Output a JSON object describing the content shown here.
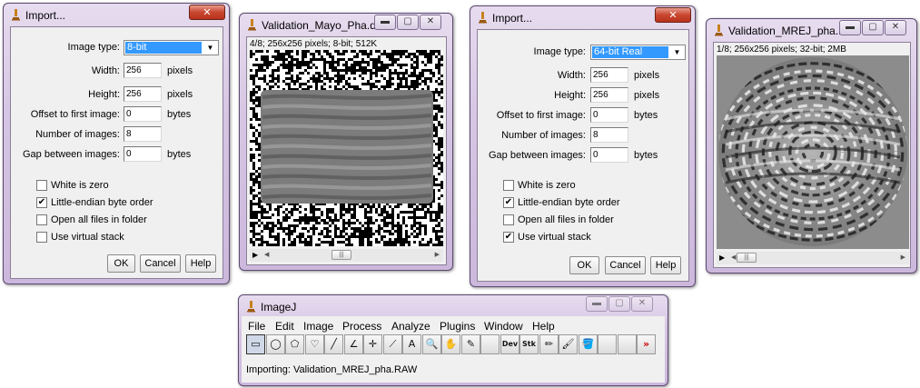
{
  "import1": {
    "title": "Import...",
    "close": "✕",
    "image_type_label": "Image type:",
    "image_type_value": "8-bit",
    "width_label": "Width:",
    "width_value": "256",
    "height_label": "Height:",
    "height_value": "256",
    "offset_label": "Offset to first image:",
    "offset_value": "0",
    "num_label": "Number of images:",
    "num_value": "8",
    "gap_label": "Gap between images:",
    "gap_value": "0",
    "unit_pixels": "pixels",
    "unit_bytes": "bytes",
    "white_zero": "White is zero",
    "white_zero_checked": false,
    "little_endian": "Little-endian byte order",
    "little_endian_checked": true,
    "open_all": "Open all files in folder",
    "open_all_checked": false,
    "virtual_stack": "Use virtual stack",
    "virtual_stack_checked": false,
    "ok": "OK",
    "cancel": "Cancel",
    "help": "Help"
  },
  "img1": {
    "title": "Validation_Mayo_Pha.dif",
    "info": "4/8; 256x256 pixels; 8-bit; 512K"
  },
  "import2": {
    "title": "Import...",
    "close": "✕",
    "image_type_label": "Image type:",
    "image_type_value": "64-bit Real",
    "width_label": "Width:",
    "width_value": "256",
    "height_label": "Height:",
    "height_value": "256",
    "offset_label": "Offset to first image:",
    "offset_value": "0",
    "num_label": "Number of images:",
    "num_value": "8",
    "gap_label": "Gap between images:",
    "gap_value": "0",
    "unit_pixels": "pixels",
    "unit_bytes": "bytes",
    "white_zero": "White is zero",
    "white_zero_checked": false,
    "little_endian": "Little-endian byte order",
    "little_endian_checked": true,
    "open_all": "Open all files in folder",
    "open_all_checked": false,
    "virtual_stack": "Use virtual stack",
    "virtual_stack_checked": true,
    "ok": "OK",
    "cancel": "Cancel",
    "help": "Help"
  },
  "img2": {
    "title": "Validation_MREJ_pha.R...",
    "info": "1/8; 256x256 pixels; 32-bit; 2MB"
  },
  "imagej": {
    "title": "ImageJ",
    "menus": [
      "File",
      "Edit",
      "Image",
      "Process",
      "Analyze",
      "Plugins",
      "Window",
      "Help"
    ],
    "tools": [
      {
        "name": "rectangle-tool-icon",
        "glyph": "▭"
      },
      {
        "name": "oval-tool-icon",
        "glyph": "◯"
      },
      {
        "name": "polygon-tool-icon",
        "glyph": "⬠"
      },
      {
        "name": "freehand-tool-icon",
        "glyph": "♡"
      },
      {
        "name": "line-tool-icon",
        "glyph": "╱"
      },
      {
        "name": "angle-tool-icon",
        "glyph": "∠"
      },
      {
        "name": "point-tool-icon",
        "glyph": "✛"
      },
      {
        "name": "wand-tool-icon",
        "glyph": "⟋"
      },
      {
        "name": "text-tool-icon",
        "glyph": "A"
      },
      {
        "name": "magnifier-tool-icon",
        "glyph": "🔍"
      },
      {
        "name": "hand-tool-icon",
        "glyph": "✋"
      },
      {
        "name": "dropper-tool-icon",
        "glyph": "✎"
      },
      {
        "name": "blank-tool-1",
        "glyph": ""
      },
      {
        "name": "dev-tool-icon",
        "glyph": "Dev"
      },
      {
        "name": "stk-tool-icon",
        "glyph": "Stk"
      },
      {
        "name": "pencil-tool-icon",
        "glyph": "✏"
      },
      {
        "name": "brush-tool-icon",
        "glyph": "🖌"
      },
      {
        "name": "flood-fill-tool-icon",
        "glyph": "🪣"
      },
      {
        "name": "blank-tool-2",
        "glyph": ""
      },
      {
        "name": "blank-tool-3",
        "glyph": ""
      },
      {
        "name": "more-tools-icon",
        "glyph": "»"
      }
    ],
    "status": "Importing: Validation_MREJ_pha.RAW"
  }
}
